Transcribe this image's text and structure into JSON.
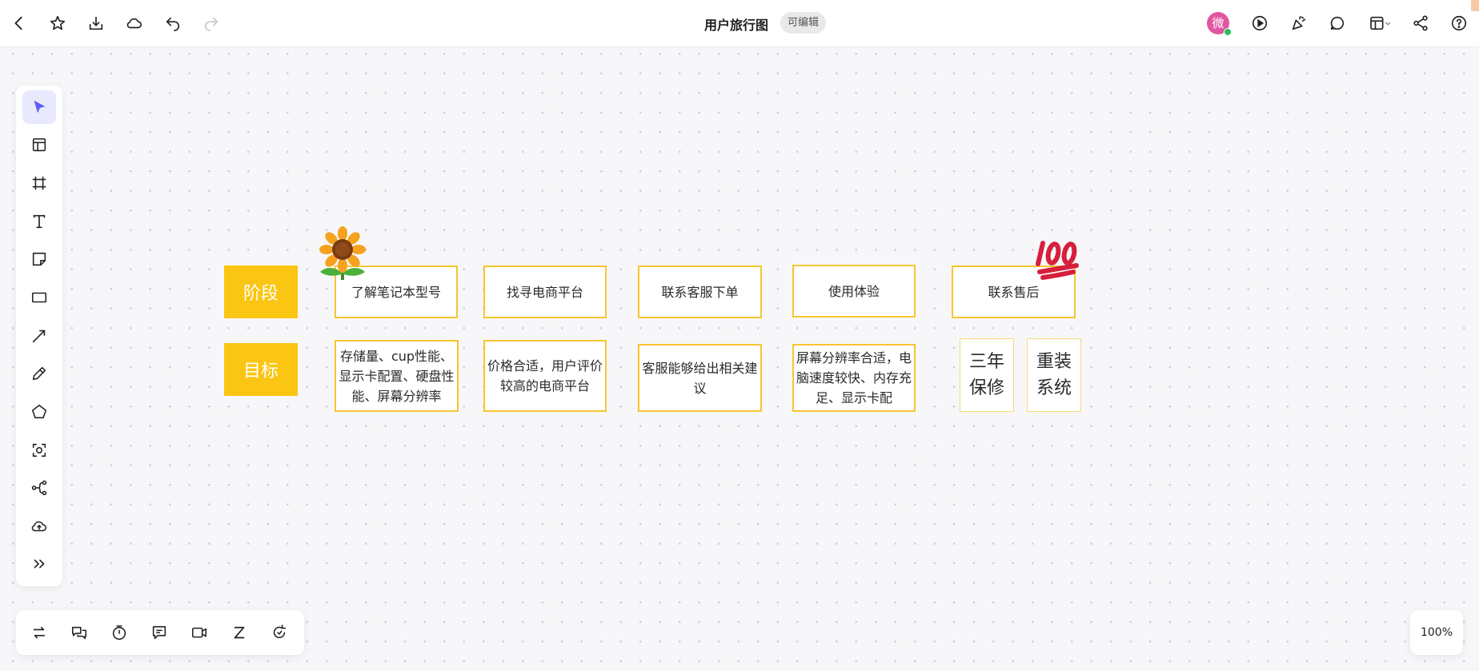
{
  "header": {
    "title": "用户旅行图",
    "badge": "可编辑",
    "avatar_initial": "微",
    "left_icons": [
      "back-icon",
      "star-icon",
      "download-icon",
      "cloud-icon",
      "undo-icon",
      "redo-icon"
    ],
    "right_icons": [
      "play-icon",
      "celebrate-icon",
      "comment-icon",
      "layout-icon",
      "share-icon",
      "help-icon"
    ]
  },
  "toolbar": {
    "tools": [
      "select-icon",
      "template-icon",
      "frame-icon",
      "text-icon",
      "sticky-note-icon",
      "rectangle-icon",
      "line-icon",
      "pen-icon",
      "polygon-icon",
      "ai-scan-icon",
      "mindmap-icon",
      "upload-icon",
      "more-icon"
    ],
    "active": "select-icon"
  },
  "bottombar": {
    "tools": [
      "swap-icon",
      "chat-icon",
      "timer-icon",
      "message-icon",
      "video-icon",
      "z-icon",
      "refresh-icon"
    ]
  },
  "zoom": "100%",
  "board": {
    "row_labels": {
      "stage": "阶段",
      "goal": "目标"
    },
    "stages": [
      "了解笔记本型号",
      "找寻电商平台",
      "联系客服下单",
      "使用体验",
      "联系售后"
    ],
    "goals": [
      "存储量、cup性能、显示卡配置、硬盘性能、屏幕分辨率",
      "价格合适，用户评价较高的电商平台",
      "客服能够给出相关建议",
      "屏幕分辨率合适，电脑速度较快、内存充足、显示卡配",
      "三年保修",
      "重装系统"
    ],
    "stickers": [
      "sunflower-sticker",
      "hundred-points-sticker"
    ]
  },
  "colors": {
    "accent": "#fbc513",
    "card_border": "#f7c531",
    "active_tool": "#5b5bf5",
    "avatar": "#e255a1"
  }
}
